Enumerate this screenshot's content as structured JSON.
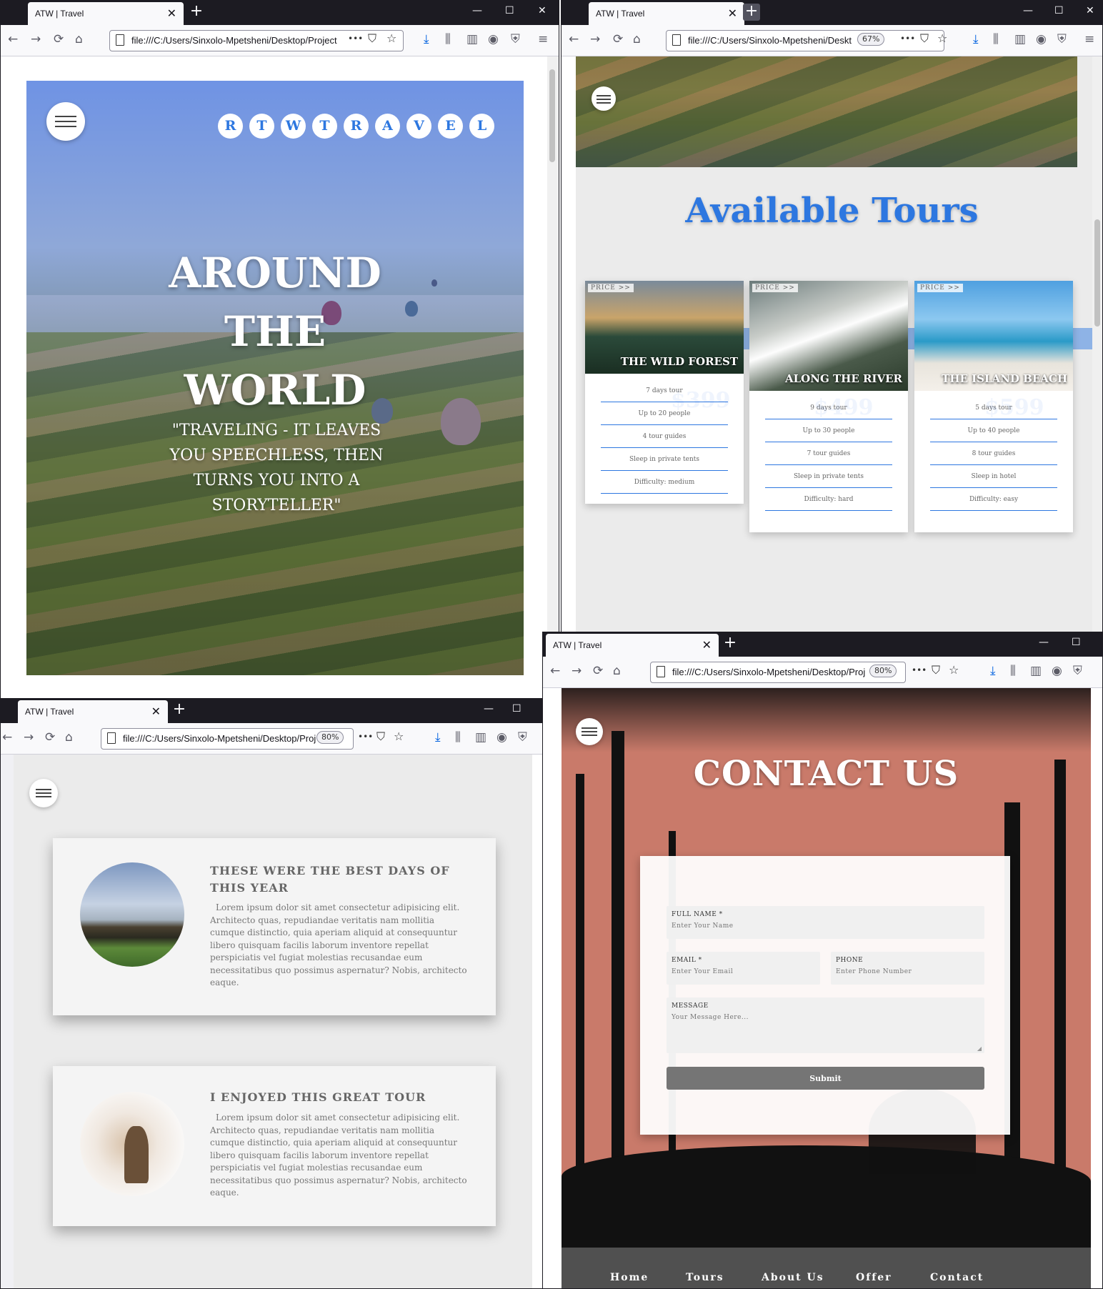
{
  "browser": {
    "tab_title": "ATW | Travel",
    "close": "✕",
    "new_tab": "+",
    "win_min": "—",
    "win_max": "☐",
    "win_close": "✕",
    "url_full": "file:///C:/Users/Sinxolo-Mpetsheni/Desktop/Project",
    "url_mid": "file:///C:/Users/Sinxolo-Mpetsheni/Deskt",
    "url_short": "file:///C:/Users/Sinxolo-Mpetsheni/Desktop/Proj",
    "zoom_67": "67%",
    "zoom_80": "80%",
    "more": "•••"
  },
  "home": {
    "brand_letters": [
      "R",
      "T",
      "W",
      "T",
      "R",
      "A",
      "V",
      "E",
      "L"
    ],
    "title_line1": "AROUND",
    "title_line2": "THE",
    "title_line3": "WORLD",
    "quote": "\"TRAVELING - IT LEAVES YOU SPEECHLESS, THEN TURNS YOU INTO A STORYTELLER\""
  },
  "tours": {
    "heading": "Available Tours",
    "price_tag": "PRICE >>",
    "items": [
      {
        "name": "THE WILD FOREST",
        "ghost_price": "$399",
        "details": [
          "7 days tour",
          "Up to 20 people",
          "4 tour guides",
          "Sleep in private tents",
          "Difficulty: medium"
        ]
      },
      {
        "name": "ALONG THE RIVER",
        "ghost_price": "$499",
        "details": [
          "9 days tour",
          "Up to 30 people",
          "7 tour guides",
          "Sleep in private tents",
          "Difficulty: hard"
        ]
      },
      {
        "name": "THE ISLAND BEACH",
        "ghost_price": "$599",
        "details": [
          "5 days tour",
          "Up to 40 people",
          "8 tour guides",
          "Sleep in hotel",
          "Difficulty: easy"
        ]
      }
    ]
  },
  "testimonials": [
    {
      "title": "THESE WERE THE BEST DAYS OF THIS YEAR",
      "text": "Lorem ipsum dolor sit amet consectetur adipisicing elit. Architecto quas, repudiandae veritatis nam mollitia cumque distinctio, quia aperiam aliquid at consequuntur libero quisquam facilis laborum inventore repellat perspiciatis vel fugiat molestias recusandae eum necessitatibus quo possimus asperna­tur? Nobis, architecto eaque."
    },
    {
      "title": "I ENJOYED THIS GREAT TOUR",
      "text": "Lorem ipsum dolor sit amet consectetur adipisicing elit. Architecto quas, repudiandae veritatis nam mollitia cumque distinctio, quia aperiam aliquid at consequuntur libero quisquam facilis laborum inventore repellat perspiciatis vel fugiat molestias recusandae eum necessitatibus quo possimus asperna­tur? Nobis, architecto eaque."
    }
  ],
  "contact": {
    "heading": "CONTACT US",
    "full_name_label": "FULL NAME *",
    "full_name_placeholder": "Enter Your Name",
    "email_label": "EMAIL *",
    "email_placeholder": "Enter Your Email",
    "phone_label": "PHONE",
    "phone_placeholder": "Enter Phone Number",
    "message_label": "MESSAGE",
    "message_placeholder": "Your Message Here...",
    "submit": "Submit"
  },
  "footer": {
    "links": [
      "Home",
      "Tours",
      "About Us",
      "Offer",
      "Contact"
    ]
  }
}
